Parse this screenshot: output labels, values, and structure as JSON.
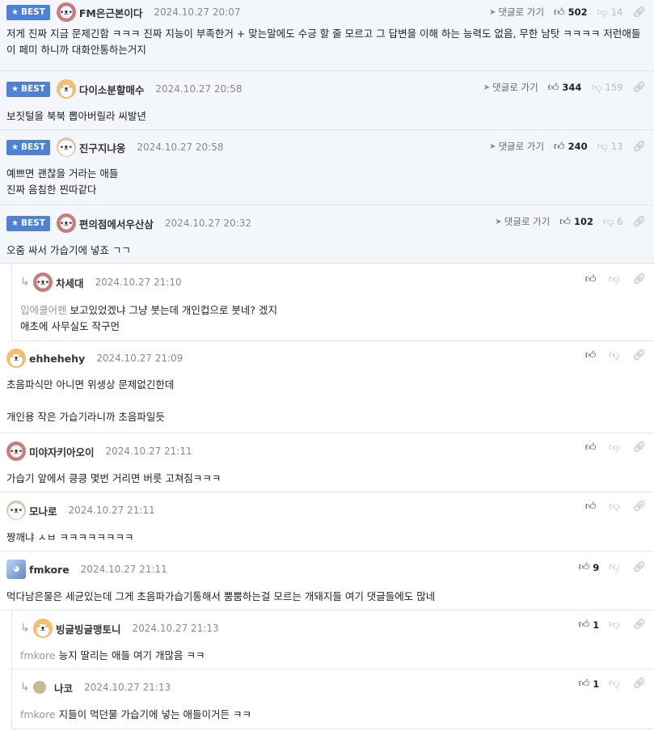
{
  "labels": {
    "best": "BEST",
    "reply_to": "댓글로 가기"
  },
  "colors": {
    "best_bg": "#f3f6fb",
    "badge": "#4d82d6"
  },
  "comments": [
    {
      "best": true,
      "nick": "FM은근본이다",
      "date": "2024.10.27 20:07",
      "up": "502",
      "down": "14",
      "reply_link": true,
      "avatar": "pink-dog-icon",
      "body": "저게 진짜 지금 문제긴함 ㅋㅋㅋ 진짜 지능이 부족한거 + 맞는말에도 수긍 할 줄 모르고 그 답변을 이해 하는 능력도 없음, 무한 남탓 ㅋㅋㅋㅋ 저런애들이 페미 하니까 대화안통하는거지"
    },
    {
      "best": true,
      "nick": "다이소분할매수",
      "date": "2024.10.27 20:58",
      "up": "344",
      "down": "159",
      "reply_link": true,
      "avatar": "shiba-icon",
      "body": "보짓털을 북북 뽑아버릴라 씨발년"
    },
    {
      "best": true,
      "nick": "진구지냐옹",
      "date": "2024.10.27 20:58",
      "up": "240",
      "down": "13",
      "reply_link": true,
      "avatar": "white-dog-icon",
      "body": "예쁘면 괜찮을 거라는 애들\n진짜 음침한 찐따같다"
    },
    {
      "best": true,
      "nick": "편의점에서우산삼",
      "date": "2024.10.27 20:32",
      "up": "102",
      "down": "6",
      "reply_link": true,
      "avatar": "pink-dog-icon",
      "body": "오줌 싸서 가습기에 넣죠 ㄱㄱ"
    },
    {
      "reply": true,
      "nick": "차세대",
      "date": "2024.10.27 21:10",
      "up": "",
      "down": "",
      "avatar": "pink-dog-icon",
      "mention": "입에쿨어펜",
      "body": "보고있었겠냐 그냥 붓는데 개인컵으로 붓네? 겠지\n애초에 사무실도 작구먼"
    },
    {
      "nick": "ehhehehy",
      "date": "2024.10.27 21:09",
      "up": "",
      "down": "",
      "avatar": "shiba-icon",
      "body": "초음파식만 아니면 위생상 문제없긴한데\n\n개인용 작은 가습기라니까 초음파일듯"
    },
    {
      "nick": "미야자키아오이",
      "date": "2024.10.27 21:11",
      "up": "",
      "down": "",
      "avatar": "pink-dog-icon",
      "body": "가습기 앞에서 킁킁 몇번 거리면 버릇 고쳐짐ㅋㅋㅋ"
    },
    {
      "nick": "모나로",
      "date": "2024.10.27 21:11",
      "up": "",
      "down": "",
      "avatar": "white-dog-icon",
      "body": "짱깨냐 ㅅㅂ ㅋㅋㅋㅋㅋㅋㅋㅋ"
    },
    {
      "nick": "fmkore",
      "date": "2024.10.27 21:11",
      "up": "9",
      "down": "",
      "avatar": "blue-avatar-icon",
      "body": "먹다남은물은 세균있는데 그게 초음파가습기통해서 뿜뿜하는걸 모르는 개돼지들 여기 댓글들에도 많네"
    },
    {
      "reply": true,
      "nick": "빙글빙글맹토니",
      "date": "2024.10.27 21:13",
      "up": "1",
      "down": "",
      "avatar": "shiba-icon",
      "mention": "fmkore",
      "body": "능지 딸리는 애들 여기 개많음 ㅋㅋ"
    },
    {
      "reply": true,
      "nick": "나코",
      "date": "2024.10.27 21:13",
      "up": "1",
      "down": "",
      "avatar": "beige-dot-icon",
      "mention": "fmkore",
      "body": "지들이 먹던물 가습기에 넣는 애들이거든 ㅋㅋ"
    }
  ]
}
